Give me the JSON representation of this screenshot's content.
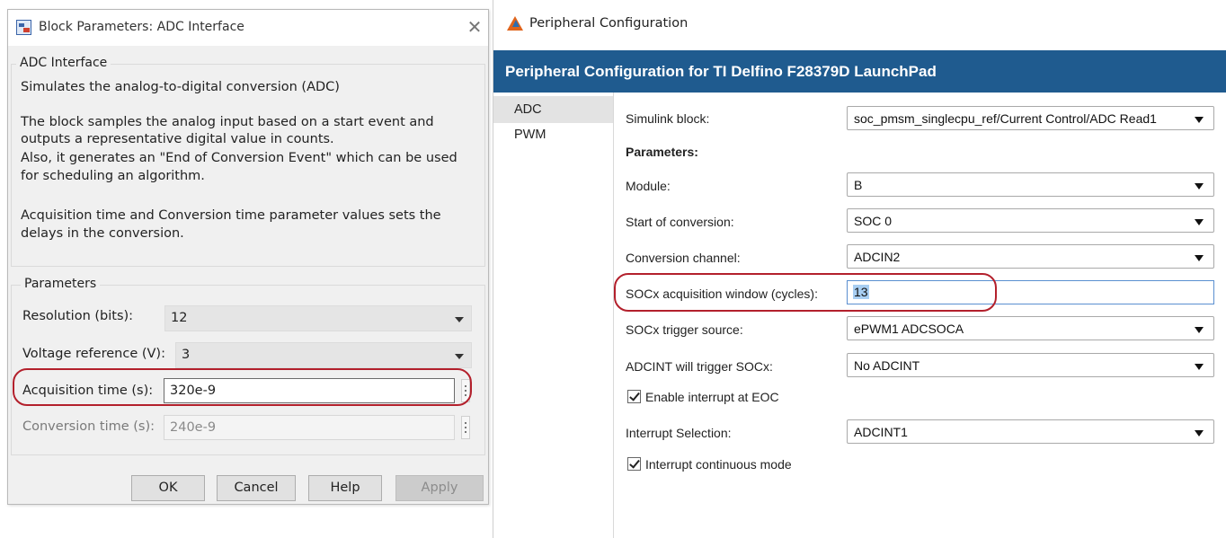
{
  "block_dialog": {
    "title": "Block Parameters: ADC Interface",
    "close_icon": "close-icon",
    "group_title": "ADC Interface",
    "description": [
      "Simulates the analog-to-digital conversion (ADC)",
      "The block samples the analog input based on a start event and",
      "outputs a representative digital value in counts.",
      "Also, it generates an \"End of Conversion Event\" which can be used",
      "for scheduling an algorithm.",
      "Acquisition time and Conversion time parameter values sets the",
      "delays in the conversion."
    ],
    "parameters_title": "Parameters",
    "resolution": {
      "label": "Resolution (bits):",
      "value": "12"
    },
    "voltage_reference": {
      "label": "Voltage reference (V):",
      "value": "3"
    },
    "acquisition_time": {
      "label": "Acquisition time (s):",
      "value": "320e-9"
    },
    "conversion_time": {
      "label": "Conversion time (s):",
      "value": "240e-9"
    },
    "buttons": {
      "ok": "OK",
      "cancel": "Cancel",
      "help": "Help",
      "apply": "Apply"
    }
  },
  "peripheral_window": {
    "title": "Peripheral Configuration",
    "banner": "Peripheral Configuration for TI Delfino F28379D LaunchPad",
    "nav": [
      "ADC",
      "PWM"
    ],
    "simulink_block": {
      "label": "Simulink block:",
      "value": "soc_pmsm_singlecpu_ref/Current Control/ADC Read1"
    },
    "parameters_heading": "Parameters:",
    "module": {
      "label": "Module:",
      "value": "B"
    },
    "start_of_conversion": {
      "label": "Start of conversion:",
      "value": "SOC 0"
    },
    "conversion_channel": {
      "label": "Conversion channel:",
      "value": "ADCIN2"
    },
    "acquisition_window": {
      "label": "SOCx acquisition window (cycles):",
      "value": "13"
    },
    "trigger_source": {
      "label": "SOCx trigger source:",
      "value": "ePWM1 ADCSOCA"
    },
    "adcint_trigger": {
      "label": "ADCINT will trigger SOCx:",
      "value": "No ADCINT"
    },
    "enable_interrupt": {
      "label": "Enable interrupt at EOC",
      "checked": true
    },
    "interrupt_selection": {
      "label": "Interrupt Selection:",
      "value": "ADCINT1"
    },
    "interrupt_continuous": {
      "label": "Interrupt continuous mode",
      "checked": true
    }
  },
  "colors": {
    "banner": "#1f5b8f",
    "callout": "#b3202c"
  }
}
